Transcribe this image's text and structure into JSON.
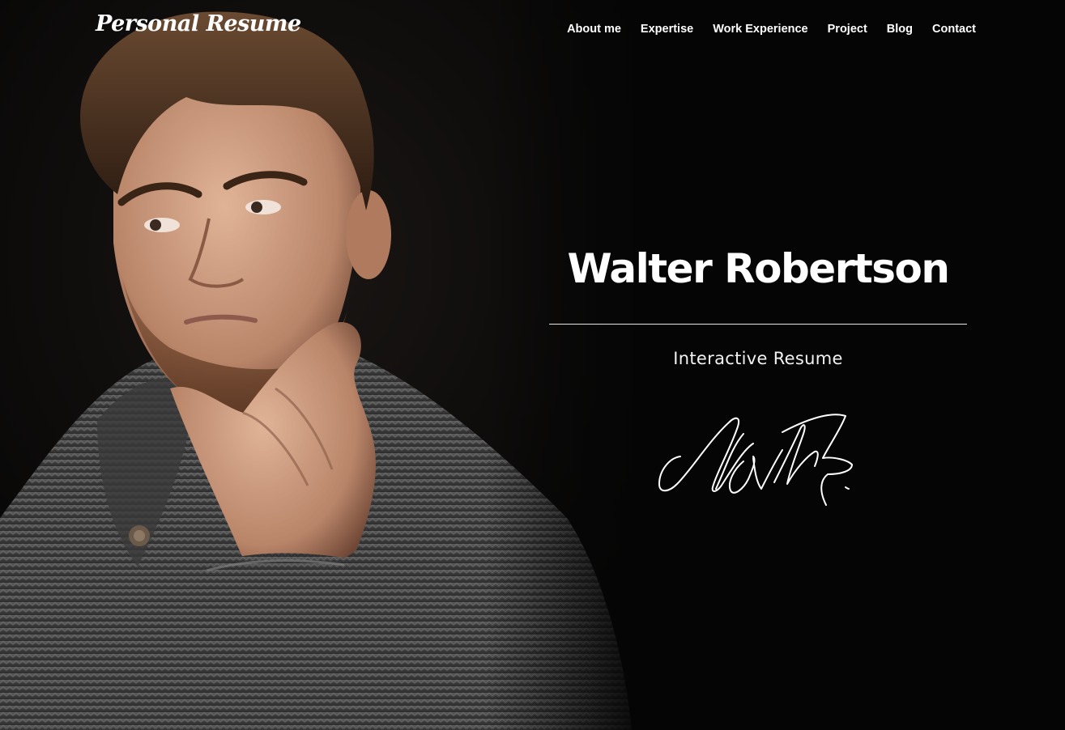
{
  "header": {
    "logo_text": "Personal Resume",
    "nav": [
      {
        "label": "About me"
      },
      {
        "label": "Expertise"
      },
      {
        "label": "Work Experience"
      },
      {
        "label": "Project"
      },
      {
        "label": "Blog"
      },
      {
        "label": "Contact"
      }
    ]
  },
  "hero": {
    "name": "Walter Robertson",
    "subtitle": "Interactive Resume",
    "signature_text": "Walter"
  },
  "colors": {
    "background": "#050505",
    "text": "#ffffff",
    "divider": "#e6e6e6",
    "sweater": "#4a4a4a",
    "skin": "#c99b80",
    "hair": "#4b3120"
  }
}
